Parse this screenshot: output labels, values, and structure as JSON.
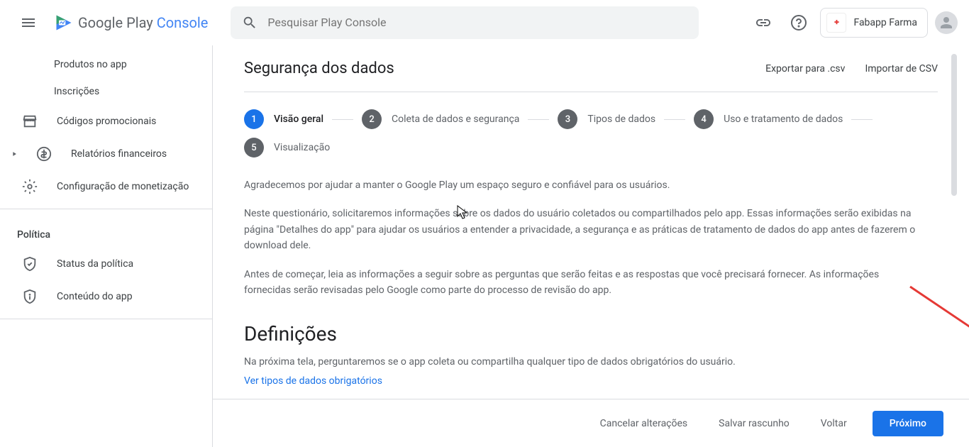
{
  "header": {
    "logo_text": "Google Play ",
    "logo_console": "Console",
    "search_placeholder": "Pesquisar Play Console",
    "dev_name": "Fabapp Farma"
  },
  "sidebar": {
    "items": [
      {
        "label": "Produtos no app"
      },
      {
        "label": "Inscrições"
      },
      {
        "label": "Códigos promocionais"
      },
      {
        "label": "Relatórios financeiros"
      },
      {
        "label": "Configuração de monetização"
      }
    ],
    "section": "Política",
    "policy_items": [
      {
        "label": "Status da política"
      },
      {
        "label": "Conteúdo do app"
      }
    ]
  },
  "page": {
    "title": "Segurança dos dados",
    "export_csv": "Exportar para .csv",
    "import_csv": "Importar de CSV"
  },
  "stepper": [
    {
      "num": "1",
      "label": "Visão geral",
      "active": true
    },
    {
      "num": "2",
      "label": "Coleta de dados e segurança",
      "active": false
    },
    {
      "num": "3",
      "label": "Tipos de dados",
      "active": false
    },
    {
      "num": "4",
      "label": "Uso e tratamento de dados",
      "active": false
    },
    {
      "num": "5",
      "label": "Visualização",
      "active": false
    }
  ],
  "body": {
    "p1": "Agradecemos por ajudar a manter o Google Play um espaço seguro e confiável para os usuários.",
    "p2": "Neste questionário, solicitaremos informações sobre os dados do usuário coletados ou compartilhados pelo app. Essas informações serão exibidas na página \"Detalhes do app\" para ajudar os usuários a entender a privacidade, a segurança e as práticas de tratamento de dados do app antes de fazerem o download dele.",
    "p3": "Antes de começar, leia as informações a seguir sobre as perguntas que serão feitas e as respostas que você precisará fornecer. As informações fornecidas serão revisadas pelo Google como parte do processo de revisão do app.",
    "heading": "Definições",
    "p4": "Na próxima tela, perguntaremos se o app coleta ou compartilha qualquer tipo de dados obrigatórios do usuário.",
    "link": "Ver tipos de dados obrigatórios"
  },
  "footer": {
    "cancel": "Cancelar alterações",
    "draft": "Salvar rascunho",
    "back": "Voltar",
    "next": "Próximo"
  }
}
